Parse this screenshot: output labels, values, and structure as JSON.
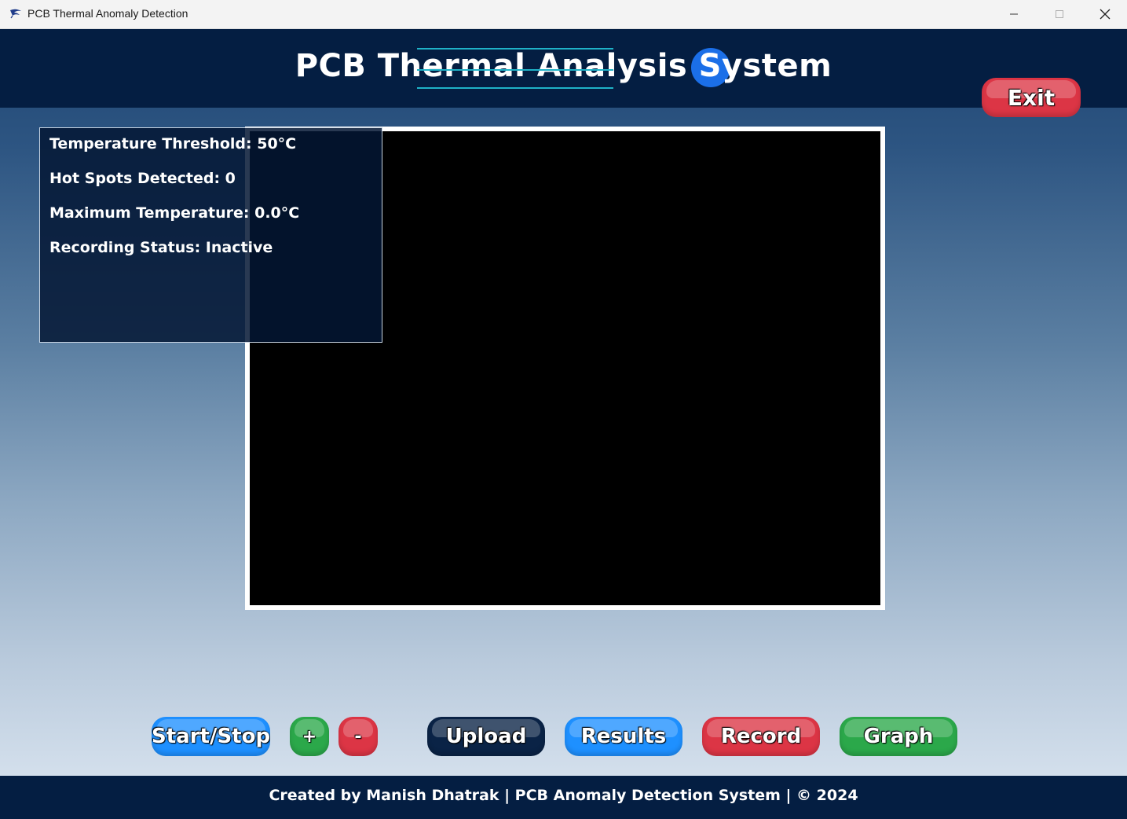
{
  "window": {
    "title": "PCB Thermal Anomaly Detection",
    "icon": "app-feather-icon",
    "controls": [
      "minimize-icon",
      "maximize-icon",
      "close-icon"
    ]
  },
  "header": {
    "title": "PCB Thermal Analysis System",
    "exit_label": "Exit"
  },
  "info_panel": {
    "threshold": "Temperature Threshold: 50°C",
    "hot_spots": "Hot Spots Detected: 0",
    "max_temp": "Maximum Temperature: 0.0°C",
    "recording": "Recording Status: Inactive"
  },
  "controls": {
    "start_stop": "Start/Stop",
    "increase": "+",
    "decrease": "-",
    "upload": "Upload",
    "results": "Results",
    "record": "Record",
    "graph": "Graph"
  },
  "footer": {
    "text": "Created by Manish Dhatrak | PCB Anomaly Detection System | © 2024"
  },
  "colors": {
    "header_bg": "#041e42",
    "accent_blue": "#1e90ff",
    "accent_green": "#2ba84a",
    "accent_red": "#dc3545",
    "title_decoration": "#1fb2c7"
  }
}
